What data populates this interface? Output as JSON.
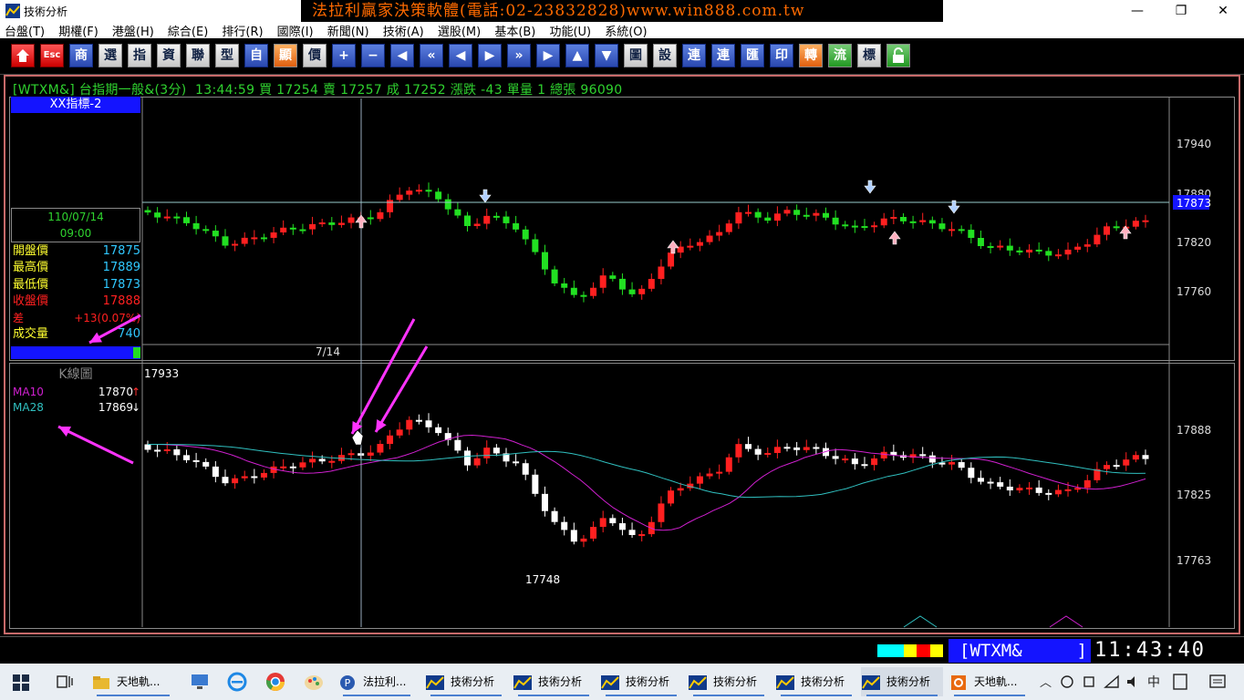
{
  "window": {
    "title": "技術分析",
    "banner": "法拉利贏家決策軟體(電話:02-23832828)www.win888.com.tw",
    "controls": {
      "minimize": "—",
      "maximize": "❐",
      "close": "✕"
    }
  },
  "menu": [
    "台盤(T)",
    "期權(F)",
    "港盤(H)",
    "綜合(E)",
    "排行(R)",
    "國際(I)",
    "新聞(N)",
    "技術(A)",
    "選股(M)",
    "基本(B)",
    "功能(U)",
    "系統(O)"
  ],
  "toolbar": [
    "首頁",
    "Esc",
    "商",
    "選",
    "指",
    "資",
    "聯",
    "型",
    "自",
    "顯",
    "價",
    "+",
    "−",
    "◀",
    "«",
    "◀",
    "▶",
    "»",
    "▶",
    "▲",
    "▼",
    "圖",
    "設",
    "連",
    "連",
    "匯",
    "印",
    "轉",
    "流",
    "標",
    "鎖"
  ],
  "quote": {
    "symbol": "[WTXM&]",
    "name": "台指期一般&(3分)",
    "time": "13:44:59",
    "buy_label": "買",
    "buy": "17254",
    "sell_label": "賣",
    "sell": "17257",
    "deal_label": "成",
    "deal": "17252",
    "change_label": "漲跌",
    "change": "-43",
    "unit_label": "單量",
    "unit": "1",
    "total_label": "總張",
    "total": "96090"
  },
  "pane1": {
    "indicator_tab": "XX指標-2",
    "date": "110/07/14",
    "time": "09:00",
    "rows": [
      {
        "label": "開盤價",
        "value": "17875"
      },
      {
        "label": "最高價",
        "value": "17889"
      },
      {
        "label": "最低價",
        "value": "17873"
      },
      {
        "label": "收盤價",
        "value": "17888"
      },
      {
        "label": "差",
        "value": "+13(0.07%)"
      },
      {
        "label": "成交量",
        "value": "740"
      }
    ],
    "date_marker": "7/14",
    "y_ticks": [
      "17940",
      "17880",
      "17820",
      "17760"
    ],
    "current_price": "17873"
  },
  "pane2": {
    "title": "K線圖",
    "ma10_label": "MA10",
    "ma10_value": "17870",
    "ma28_label": "MA28",
    "ma28_value": "17869",
    "high_label": "17933",
    "low_label": "17748",
    "y_ticks": [
      "17888",
      "17825",
      "17763"
    ]
  },
  "status": {
    "symbol": "WTXM&",
    "clock": "11:43:40",
    "color_chips": [
      "#00ffff",
      "#00ffff",
      "#ffff00",
      "#ff0000",
      "#ffff00"
    ]
  },
  "taskbar": {
    "items": [
      {
        "label": "天地軌...",
        "icon": "folder-icon"
      },
      {
        "label": "法拉利...",
        "icon": "ferrari-app-icon"
      },
      {
        "label": "技術分析",
        "icon": "chart-app-icon"
      },
      {
        "label": "技術分析",
        "icon": "chart-app-icon"
      },
      {
        "label": "技術分析",
        "icon": "chart-app-icon"
      },
      {
        "label": "技術分析",
        "icon": "chart-app-icon"
      },
      {
        "label": "技術分析",
        "icon": "chart-app-icon"
      },
      {
        "label": "技術分析",
        "icon": "chart-app-icon"
      },
      {
        "label": "天地軌...",
        "icon": "office-icon"
      }
    ],
    "tray_lang": "中"
  },
  "colors": {
    "up": "#ff2020",
    "down_pane1": "#22e022",
    "down_pane2": "#ffffff",
    "ma10": "#d020d0",
    "ma28": "#30c0c0",
    "annotation": "#ff33ff"
  }
}
